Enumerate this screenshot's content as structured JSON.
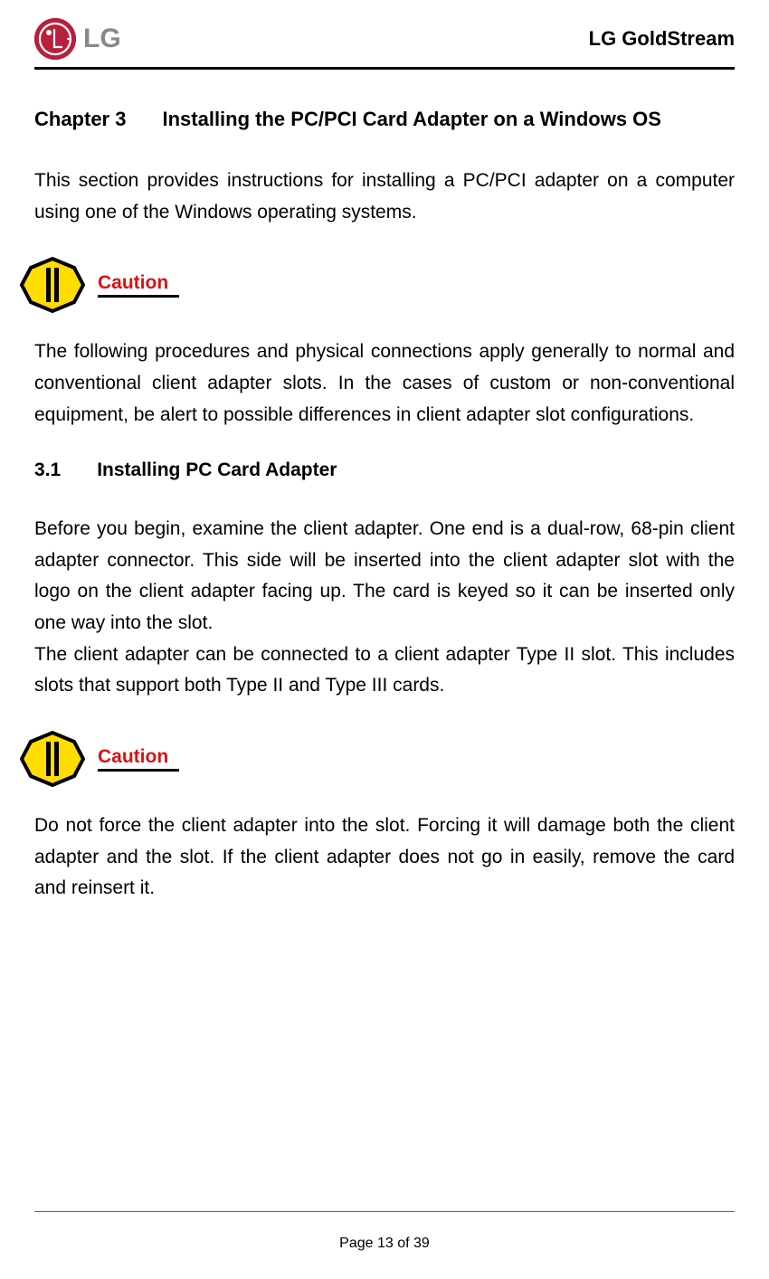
{
  "header": {
    "logo_text": "LG",
    "doc_title": "LG GoldStream"
  },
  "chapter": {
    "number": "Chapter 3",
    "title": "Installing the PC/PCI Card Adapter on a Windows OS"
  },
  "intro_text": "This section provides instructions for installing a PC/PCI adapter on a computer using one of the Windows operating systems.",
  "caution1": {
    "label": "Caution",
    "text": "The following procedures and physical connections apply generally to normal and conventional client adapter slots. In the cases of custom or non-conventional equipment, be alert to possible differences in client adapter slot configurations."
  },
  "section": {
    "number": "3.1",
    "title": "Installing PC Card Adapter"
  },
  "section_text1": "Before you begin, examine the client adapter. One end is a dual-row, 68-pin client adapter connector. This side will be inserted into the client adapter slot with the logo on the client adapter facing up. The card is keyed so it can be inserted only one way into the slot.",
  "section_text2": "The client adapter can be connected to a client adapter Type II slot. This includes slots that support both Type II and Type III cards.",
  "caution2": {
    "label": "Caution",
    "text": "Do not force the client adapter into the slot. Forcing it will damage both the client adapter and the slot. If the client adapter does not go in easily, remove the card and reinsert it."
  },
  "footer": {
    "page_text": "Page 13 of 39"
  }
}
